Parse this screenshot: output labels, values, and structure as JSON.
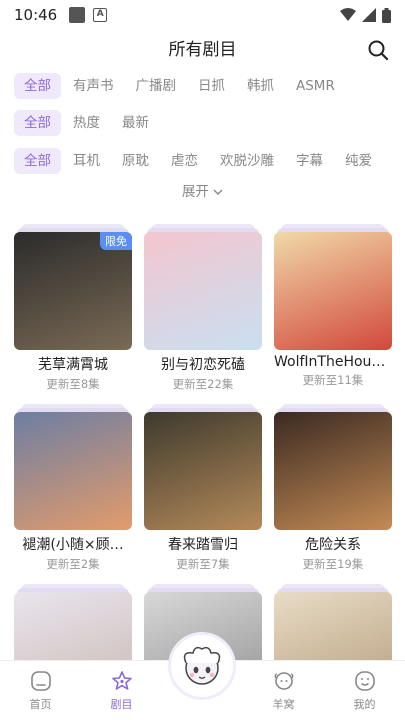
{
  "status": {
    "time": "10:46"
  },
  "header": {
    "title": "所有剧目"
  },
  "filters": {
    "row1": [
      "全部",
      "有声书",
      "广播剧",
      "日抓",
      "韩抓",
      "ASMR"
    ],
    "row2": [
      "全部",
      "热度",
      "最新"
    ],
    "row3": [
      "全部",
      "耳机",
      "原耽",
      "虐恋",
      "欢脱沙雕",
      "字幕",
      "纯爱"
    ],
    "expand": "展开"
  },
  "cards": [
    {
      "name": "芜草满霄城",
      "episodes": "更新至8集",
      "badge": "限免",
      "colors": [
        "#2b2b2b",
        "#7a6a55"
      ]
    },
    {
      "name": "别与初恋死磕",
      "episodes": "更新至22集",
      "badge": "",
      "colors": [
        "#f3c6cf",
        "#c9dff0"
      ]
    },
    {
      "name": "WolfInTheHous…",
      "episodes": "更新至11集",
      "badge": "",
      "colors": [
        "#f1d9a8",
        "#d2483d"
      ]
    },
    {
      "name": "褪潮(小随×顾…",
      "episodes": "更新至2集",
      "badge": "",
      "colors": [
        "#6d7ea3",
        "#e39b6b"
      ]
    },
    {
      "name": "春来踏雪归",
      "episodes": "更新至7集",
      "badge": "",
      "colors": [
        "#3d3a2d",
        "#b58a5a"
      ]
    },
    {
      "name": "危险关系",
      "episodes": "更新至19集",
      "badge": "",
      "colors": [
        "#3a2a22",
        "#c48b55"
      ]
    },
    {
      "name": "",
      "episodes": "",
      "badge": "",
      "colors": [
        "#e9e4ee",
        "#c8b9b1"
      ]
    },
    {
      "name": "",
      "episodes": "",
      "badge": "",
      "colors": [
        "#d8d8d8",
        "#8f8f8f"
      ]
    },
    {
      "name": "",
      "episodes": "",
      "badge": "",
      "colors": [
        "#e8dcc6",
        "#b49a7a"
      ]
    }
  ],
  "tabs": [
    "首页",
    "剧目",
    "羊窝",
    "我的"
  ],
  "accent": "#8c6ad6"
}
